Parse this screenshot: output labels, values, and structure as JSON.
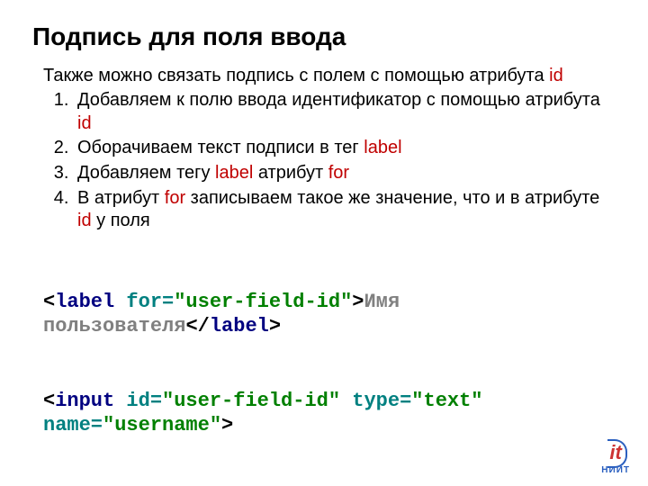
{
  "title": "Подпись для поля ввода",
  "intro_parts": {
    "a": "Также можно связать подпись с полем с помощью атрибута ",
    "b": "id"
  },
  "steps": [
    {
      "a": "Добавляем к полю ввода идентификатор с помощью атрибута ",
      "b": "id",
      "c": ""
    },
    {
      "a": "Оборачиваем текст подписи в тег ",
      "b": "label",
      "c": ""
    },
    {
      "a": "Добавляем тегу ",
      "b": "label",
      "c": " атрибут ",
      "d": "for"
    },
    {
      "a": "В атрибут ",
      "b": "for",
      "c": " записываем такое же значение, что и в атрибуте ",
      "d": "id",
      "e": " у поля"
    }
  ],
  "code": {
    "l1": {
      "lt": "<",
      "tag": "label",
      "sp": " ",
      "attr": "for=",
      "val": "\"user-field-id\"",
      "gt": ">",
      "text": "Имя пользователя",
      "lt2": "</",
      "tag2": "label",
      "gt2": ">"
    },
    "l2": {
      "lt": "<",
      "tag": "input",
      "sp": " ",
      "attr1": "id=",
      "val1": "\"user-field-id\"",
      "sp2": " ",
      "attr2": "type=",
      "val2": "\"text\"",
      "sp3": " ",
      "attr3": "name=",
      "val3": "\"username\"",
      "gt": ">"
    }
  },
  "logo": {
    "it": "it",
    "name": "НИИТ"
  }
}
